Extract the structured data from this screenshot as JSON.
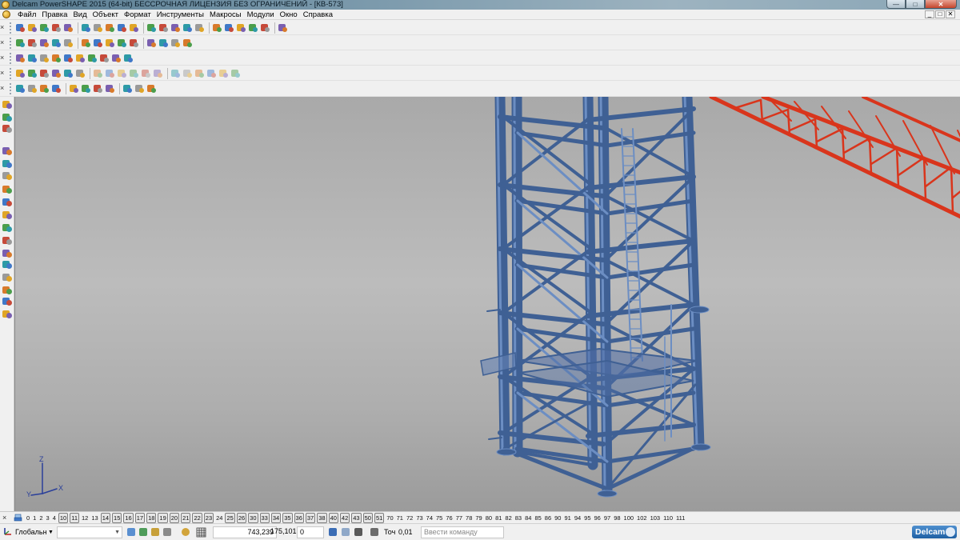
{
  "window": {
    "title": "Delcam PowerSHAPE 2015 (64-bit) БЕССРОЧНАЯ ЛИЦЕНЗИЯ БЕЗ ОГРАНИЧЕНИЙ - [КВ-573]",
    "minimize": "—",
    "restore": "□",
    "close": "✕"
  },
  "menu": {
    "items": [
      "Файл",
      "Правка",
      "Вид",
      "Объект",
      "Формат",
      "Инструменты",
      "Макросы",
      "Модули",
      "Окно",
      "Справка"
    ],
    "doc_buttons": [
      "_",
      "□",
      "✕"
    ]
  },
  "toolbars": {
    "close_glyph": "×",
    "row1_icons": [
      "open-file-icon",
      "new-folder-icon",
      "save-icon",
      "save-as-icon",
      "print-icon",
      "cut-icon",
      "copy-icon",
      "paste-icon",
      "delete-icon",
      "undo-icon",
      "redo-icon",
      "select-icon",
      "pick-icon",
      "circle-icon",
      "curve-icon",
      "text-icon",
      "measure-icon",
      "shade-icon",
      "wireframe-icon",
      "render-icon",
      "magic-icon"
    ],
    "row2_icons": [
      "view-front-icon",
      "view-back-icon",
      "view-iso-icon",
      "view-top-icon",
      "view-side-icon",
      "zoom-in-icon",
      "zoom-out-icon",
      "zoom-fit-icon",
      "zoom-box-icon",
      "globe-icon",
      "shaded-view-icon",
      "shaded-edges-icon",
      "light-icon",
      "pan-hand-icon"
    ],
    "row3_icons": [
      "mobile-icon",
      "document-icon",
      "layers-icon",
      "solid-icon",
      "sphere-icon",
      "play-icon",
      "pipe-icon",
      "feature-icon",
      "arrow-icon",
      "macro-icon"
    ],
    "row4_icons": [
      "extrude-icon",
      "revolve-icon",
      "box-solid-icon",
      "cylinder-icon",
      "cone-icon",
      "torus-icon",
      "spring-icon",
      "shell-icon",
      "blend-icon",
      "chamfer-icon",
      "draft-icon",
      "cut-solid-icon",
      "boolean-icon",
      "split-icon",
      "offset-icon",
      "mirror-icon",
      "pattern-icon",
      "history-icon"
    ],
    "row5_icons": [
      "surface-icon",
      "fillet-icon",
      "sweep-icon",
      "loft-icon",
      "patch-icon",
      "trim-icon",
      "extend-icon",
      "knit-icon",
      "morph-icon",
      "sheet-icon",
      "decal-icon"
    ]
  },
  "left_toolbar": {
    "icons": [
      "select-arrow-icon",
      "drawing-icon",
      "workplane-icon",
      "line-icon",
      "arc-icon",
      "curve-tool-icon",
      "text-tool-icon",
      "surface-tool-icon",
      "solid-tool-icon",
      "mesh-tool-icon",
      "dimension-icon",
      "symbol-icon",
      "object-info-icon",
      "analyze-icon",
      "light-tool-icon",
      "assembly-icon",
      "electrode-icon"
    ]
  },
  "viewport": {
    "axis_labels": {
      "x": "X",
      "y": "Y",
      "z": "Z"
    },
    "colors": {
      "tower": "#3f6094",
      "tower_highlight": "#6c8ec3",
      "boom": "#d9351c",
      "background_top": "#a9a9a9",
      "background_bottom": "#9b9b9b"
    }
  },
  "level_bar": {
    "close_glyph": "×",
    "levels": [
      {
        "n": "0",
        "used": false
      },
      {
        "n": "1",
        "used": false
      },
      {
        "n": "2",
        "used": false
      },
      {
        "n": "3",
        "used": false
      },
      {
        "n": "4",
        "used": false
      },
      {
        "n": "10",
        "used": true
      },
      {
        "n": "11",
        "used": true
      },
      {
        "n": "12",
        "used": false
      },
      {
        "n": "13",
        "used": false
      },
      {
        "n": "14",
        "used": true
      },
      {
        "n": "15",
        "used": true
      },
      {
        "n": "16",
        "used": true
      },
      {
        "n": "17",
        "used": true
      },
      {
        "n": "18",
        "used": true
      },
      {
        "n": "19",
        "used": true
      },
      {
        "n": "20",
        "used": true
      },
      {
        "n": "21",
        "used": true
      },
      {
        "n": "22",
        "used": true
      },
      {
        "n": "23",
        "used": true
      },
      {
        "n": "24",
        "used": false
      },
      {
        "n": "25",
        "used": true
      },
      {
        "n": "26",
        "used": true
      },
      {
        "n": "30",
        "used": true
      },
      {
        "n": "33",
        "used": true
      },
      {
        "n": "34",
        "used": true
      },
      {
        "n": "35",
        "used": true
      },
      {
        "n": "36",
        "used": true
      },
      {
        "n": "37",
        "used": true
      },
      {
        "n": "38",
        "used": true
      },
      {
        "n": "40",
        "used": true
      },
      {
        "n": "42",
        "used": true
      },
      {
        "n": "43",
        "used": true
      },
      {
        "n": "50",
        "used": true
      },
      {
        "n": "51",
        "used": true
      },
      {
        "n": "70",
        "used": false
      },
      {
        "n": "71",
        "used": false
      },
      {
        "n": "72",
        "used": false
      },
      {
        "n": "73",
        "used": false
      },
      {
        "n": "74",
        "used": false
      },
      {
        "n": "75",
        "used": false
      },
      {
        "n": "76",
        "used": false
      },
      {
        "n": "77",
        "used": false
      },
      {
        "n": "78",
        "used": false
      },
      {
        "n": "79",
        "used": false
      },
      {
        "n": "80",
        "used": false
      },
      {
        "n": "81",
        "used": false
      },
      {
        "n": "82",
        "used": false
      },
      {
        "n": "83",
        "used": false
      },
      {
        "n": "84",
        "used": false
      },
      {
        "n": "85",
        "used": false
      },
      {
        "n": "86",
        "used": false
      },
      {
        "n": "90",
        "used": false
      },
      {
        "n": "91",
        "used": false
      },
      {
        "n": "94",
        "used": false
      },
      {
        "n": "95",
        "used": false
      },
      {
        "n": "96",
        "used": false
      },
      {
        "n": "97",
        "used": false
      },
      {
        "n": "98",
        "used": false
      },
      {
        "n": "100",
        "used": false
      },
      {
        "n": "102",
        "used": false
      },
      {
        "n": "103",
        "used": false
      },
      {
        "n": "110",
        "used": false
      },
      {
        "n": "111",
        "used": false
      }
    ]
  },
  "status_bar": {
    "workplane": "Глобальн",
    "combo_value": "",
    "coord_x": "743,239",
    "coord_y": "175,101",
    "coord_z": "0",
    "tolerance_label": "Точ",
    "tolerance_value": "0,01",
    "command_placeholder": "Ввести команду",
    "logo_text": "Delcam"
  }
}
